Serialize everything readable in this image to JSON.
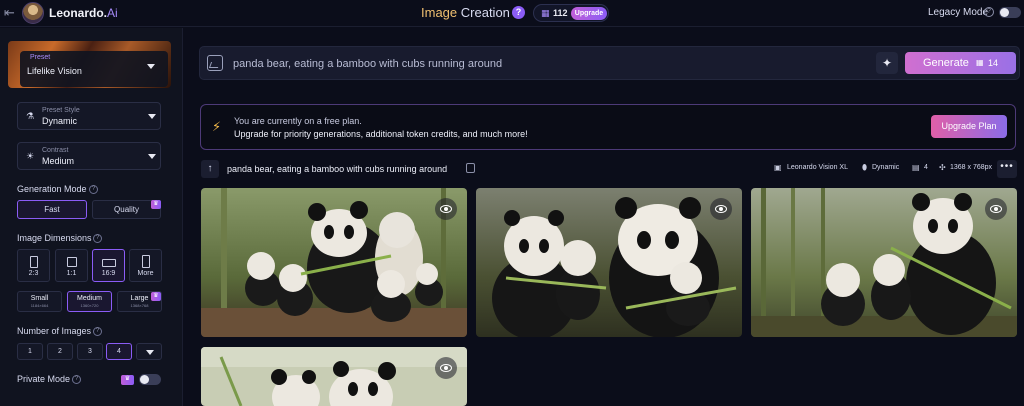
{
  "app": {
    "brand_name": "Leonardo.",
    "brand_suffix": "Ai",
    "page_title_word1": "Image",
    "page_title_word2": "Creation",
    "help_badge": "?",
    "token_count": "112",
    "upgrade_label": "Upgrade",
    "legacy_mode_label": "Legacy Mode",
    "legacy_help": "?"
  },
  "sidebar": {
    "preset_label": "Preset",
    "preset_value": "Lifelike Vision",
    "preset_style_label": "Preset Style",
    "preset_style_value": "Dynamic",
    "contrast_label": "Contrast",
    "contrast_value": "Medium",
    "generation_mode_title": "Generation Mode",
    "mode_fast": "Fast",
    "mode_quality": "Quality",
    "image_dimensions_title": "Image Dimensions",
    "dims": [
      {
        "label": "2:3"
      },
      {
        "label": "1:1"
      },
      {
        "label": "16:9"
      },
      {
        "label": "More"
      }
    ],
    "sizes": [
      {
        "label": "Small",
        "sub": "1184×664"
      },
      {
        "label": "Medium",
        "sub": "1360×720"
      },
      {
        "label": "Large",
        "sub": "1368×768"
      }
    ],
    "number_of_images_title": "Number of Images",
    "numbers": [
      "1",
      "2",
      "3",
      "4"
    ],
    "private_mode_label": "Private Mode"
  },
  "prompt": {
    "text": "panda bear, eating a bamboo with cubs running around",
    "generate_label": "Generate",
    "generate_cost": "14"
  },
  "banner": {
    "line1": "You are currently on a free plan.",
    "line2": "Upgrade for priority generations, additional token credits, and much more!",
    "button": "Upgrade Plan"
  },
  "generation": {
    "prompt": "panda bear, eating a bamboo with cubs running around",
    "model": "Leonardo Vision XL",
    "style": "Dynamic",
    "count": "4",
    "resolution": "1368 x 768px",
    "more": "•••"
  },
  "colors": {
    "accent": "#8b5cf6",
    "generate_gradient_start": "#d06fd0",
    "generate_gradient_end": "#9a70e6",
    "background": "#0b0d1a"
  }
}
